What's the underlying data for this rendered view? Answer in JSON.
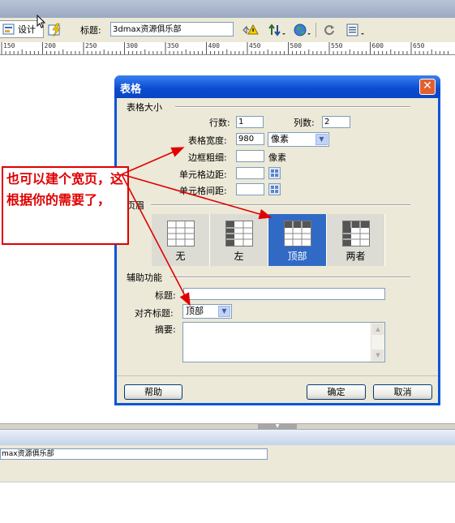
{
  "toolbar": {
    "design_label": "设计",
    "title_label": "标题:",
    "title_value": "3dmax资源俱乐部"
  },
  "ruler": {
    "ticks": [
      "150",
      "200",
      "250",
      "300",
      "350",
      "400",
      "450",
      "500",
      "550",
      "600",
      "650"
    ]
  },
  "dialog": {
    "title": "表格",
    "section_size": "表格大小",
    "rows_label": "行数:",
    "rows_value": "1",
    "cols_label": "列数:",
    "cols_value": "2",
    "width_label": "表格宽度:",
    "width_value": "980",
    "width_unit": "像素",
    "border_label": "边框粗细:",
    "border_value": "",
    "border_unit": "像素",
    "padding_label": "单元格边距:",
    "padding_value": "",
    "spacing_label": "单元格间距:",
    "spacing_value": "",
    "section_header": "页眉",
    "header_options": [
      {
        "label": "无",
        "selected": false
      },
      {
        "label": "左",
        "selected": false
      },
      {
        "label": "顶部",
        "selected": true
      },
      {
        "label": "两者",
        "selected": false
      }
    ],
    "section_access": "辅助功能",
    "caption_label": "标题:",
    "caption_value": "",
    "align_label": "对齐标题:",
    "align_value": "顶部",
    "summary_label": "摘要:",
    "summary_value": "",
    "help_button": "帮助",
    "ok_button": "确定",
    "cancel_button": "取消"
  },
  "properties": {
    "title_value": "max资源俱乐部"
  },
  "annotation": {
    "text": "也可以建个宽页，这根据你的需要了，"
  },
  "colors": {
    "dialog_title": "#0a4bd0",
    "selected_option": "#316ac5",
    "annotation": "#e00000"
  }
}
